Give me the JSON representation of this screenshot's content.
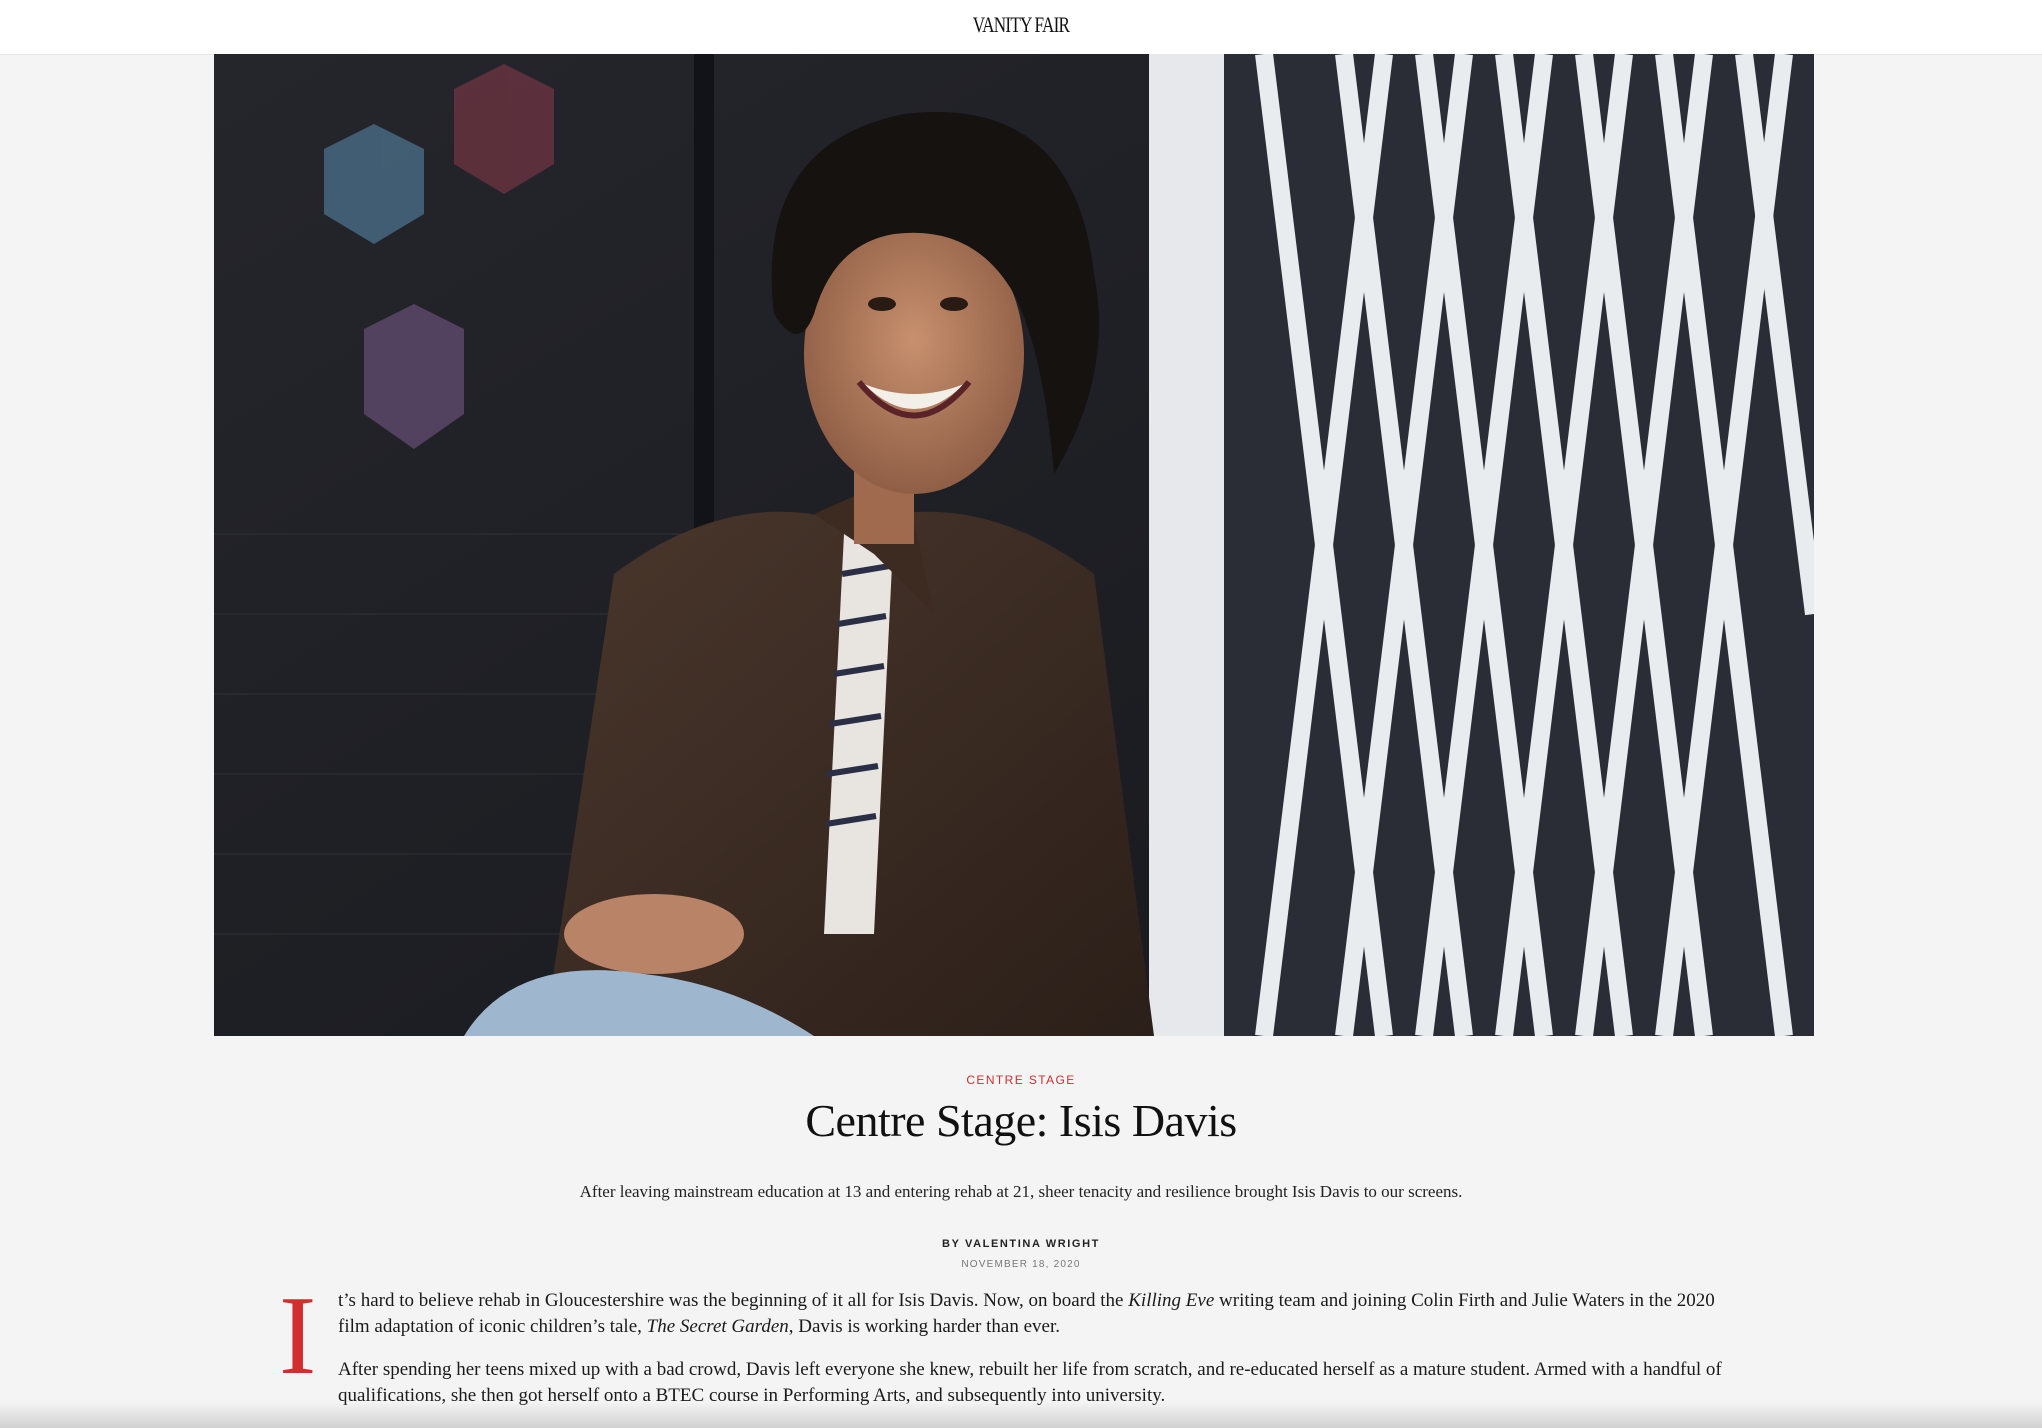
{
  "header": {
    "logo": "VANITY FAIR"
  },
  "hero": {
    "image_icon": "portrait-photo",
    "colors": {
      "wall": "#1f2026",
      "jacket": "#3a2a22",
      "gate": "#e9ecef",
      "background_page": "#f4f4f4"
    }
  },
  "article": {
    "kicker": "CENTRE STAGE",
    "headline": "Centre Stage: Isis Davis",
    "dek": "After leaving mainstream education at 13 and entering rehab at 21, sheer tenacity and resilience brought Isis Davis to our screens.",
    "byline": "BY VALENTINA WRIGHT",
    "date": "NOVEMBER 18, 2020",
    "dropcap": "I",
    "paragraph1": {
      "part1": "t’s hard to believe rehab in Gloucestershire was the beginning of it all for Isis Davis. Now, on board the ",
      "italic1": "Killing Eve",
      "part2": " writing team and joining Colin Firth and Julie Waters in the 2020 film adaptation of iconic children’s tale, ",
      "italic2": "The Secret Garden",
      "part3": ", Davis is working harder than ever."
    },
    "paragraph2": "After spending her teens mixed up with a bad crowd, Davis left everyone she knew, rebuilt her life from scratch, and re-educated herself as a mature student. Armed with a handful of qualifications, she then got herself onto a BTEC course in Performing Arts, and subsequently into university.",
    "accent_color": "#d22e2e"
  }
}
